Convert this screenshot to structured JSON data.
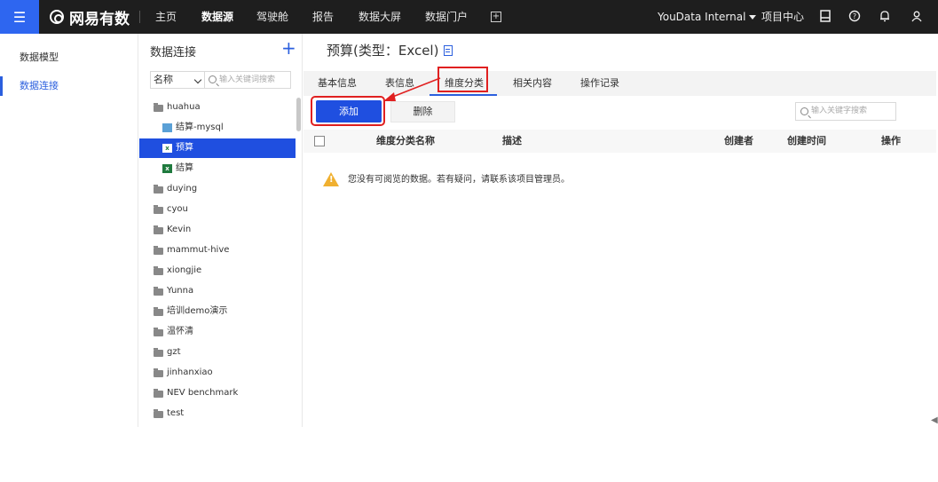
{
  "topbar": {
    "menu_icon": "hamburger-icon",
    "brand": "网易有数",
    "nav": [
      "主页",
      "数据源",
      "驾驶舱",
      "报告",
      "数据大屏",
      "数据门户"
    ],
    "active_nav": "数据源",
    "workspace": "YouData Internal",
    "project_center": "项目中心",
    "icons": [
      "bookmark-icon",
      "help-icon",
      "bell-icon",
      "user-icon"
    ],
    "accent": "#2e66f0"
  },
  "sidebar": {
    "items": [
      {
        "label": "数据模型",
        "active": false
      },
      {
        "label": "数据连接",
        "active": true
      }
    ]
  },
  "tree": {
    "title": "数据连接",
    "filter_select": "名称",
    "filter_placeholder": "输入关键词搜索",
    "rows": [
      {
        "label": "huahua",
        "icon": "folder-icon",
        "level": 0,
        "selected": false
      },
      {
        "label": "结算-mysql",
        "icon": "database-icon",
        "level": 1,
        "selected": false
      },
      {
        "label": "预算",
        "icon": "excel-icon",
        "level": 1,
        "selected": true
      },
      {
        "label": "结算",
        "icon": "excel-icon",
        "level": 1,
        "selected": false
      },
      {
        "label": "duying",
        "icon": "folder-icon",
        "level": 0,
        "selected": false
      },
      {
        "label": "cyou",
        "icon": "folder-icon",
        "level": 0,
        "selected": false
      },
      {
        "label": "Kevin",
        "icon": "folder-icon",
        "level": 0,
        "selected": false
      },
      {
        "label": "mammut-hive",
        "icon": "folder-icon",
        "level": 0,
        "selected": false
      },
      {
        "label": "xiongjie",
        "icon": "folder-icon",
        "level": 0,
        "selected": false
      },
      {
        "label": "Yunna",
        "icon": "folder-icon",
        "level": 0,
        "selected": false
      },
      {
        "label": "培训demo演示",
        "icon": "folder-icon",
        "level": 0,
        "selected": false
      },
      {
        "label": "温怀清",
        "icon": "folder-icon",
        "level": 0,
        "selected": false
      },
      {
        "label": "gzt",
        "icon": "folder-icon",
        "level": 0,
        "selected": false
      },
      {
        "label": "jinhanxiao",
        "icon": "folder-icon",
        "level": 0,
        "selected": false
      },
      {
        "label": "NEV benchmark",
        "icon": "folder-icon",
        "level": 0,
        "selected": false
      },
      {
        "label": "test",
        "icon": "folder-icon",
        "level": 0,
        "selected": false
      }
    ]
  },
  "main": {
    "title": "预算(类型：Excel)",
    "tabs": [
      "基本信息",
      "表信息",
      "维度分类",
      "相关内容",
      "操作记录"
    ],
    "active_tab": "维度分类",
    "add_button": "添加",
    "delete_button": "删除",
    "search_placeholder": "输入关键字搜索",
    "columns": [
      "维度分类名称",
      "描述",
      "创建者",
      "创建时间",
      "操作"
    ],
    "empty_notice": "您没有可阅览的数据。若有疑问，请联系该项目管理员。",
    "highlight_color": "#e02020"
  }
}
